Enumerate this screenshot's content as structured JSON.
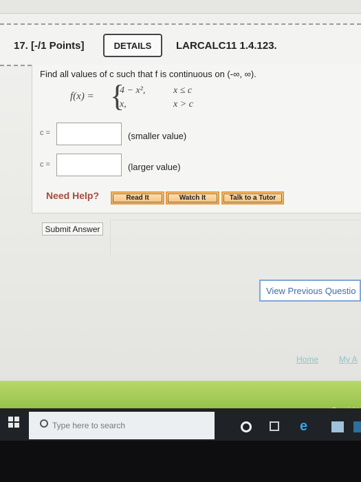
{
  "question": {
    "number_points": "17. [-/1 Points]",
    "details_label": "DETAILS",
    "code": "LARCALC11 1.4.123.",
    "prompt": "Find all values of c such that f is continuous on (-∞, ∞).",
    "function_lhs": "f(x) =",
    "case1_expr": "4 − x²,",
    "case1_cond": "x ≤ c",
    "case2_expr": "x,",
    "case2_cond": "x > c"
  },
  "answers": {
    "c_label": "c =",
    "smaller_hint": "(smaller value)",
    "larger_hint": "(larger value)",
    "smaller_value": "",
    "larger_value": ""
  },
  "help": {
    "need_help": "Need Help?",
    "read_it": "Read It",
    "watch_it": "Watch It",
    "talk_to_tutor": "Talk to a Tutor"
  },
  "actions": {
    "submit_answer": "Submit Answer",
    "view_previous": "View Previous Questio"
  },
  "footer": {
    "home": "Home",
    "my_a": "My A",
    "copyright": "Copyright"
  },
  "taskbar": {
    "search_placeholder": "Type here to search"
  },
  "colors": {
    "need_help": "#a74a3c",
    "help_button": "#f5c07d",
    "view_previous_border": "#7fa8d6",
    "footer_bar": "#98c24c"
  }
}
